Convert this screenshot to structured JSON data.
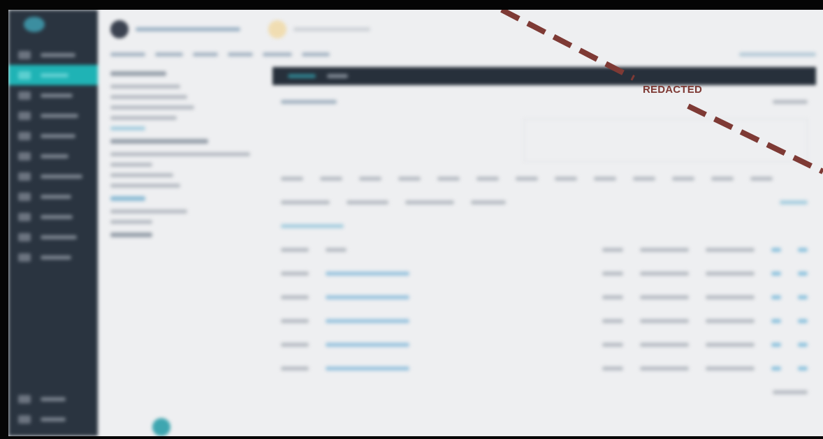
{
  "sidebar": {
    "items": [
      {
        "selected": false
      },
      {
        "selected": true
      },
      {
        "selected": false
      },
      {
        "selected": false
      },
      {
        "selected": false
      },
      {
        "selected": false
      },
      {
        "selected": false
      },
      {
        "selected": false
      },
      {
        "selected": false
      },
      {
        "selected": false
      },
      {
        "selected": false
      }
    ],
    "bottom_items": [
      {
        "selected": false
      },
      {
        "selected": false
      }
    ]
  },
  "redaction": {
    "label": "REDACTED"
  }
}
